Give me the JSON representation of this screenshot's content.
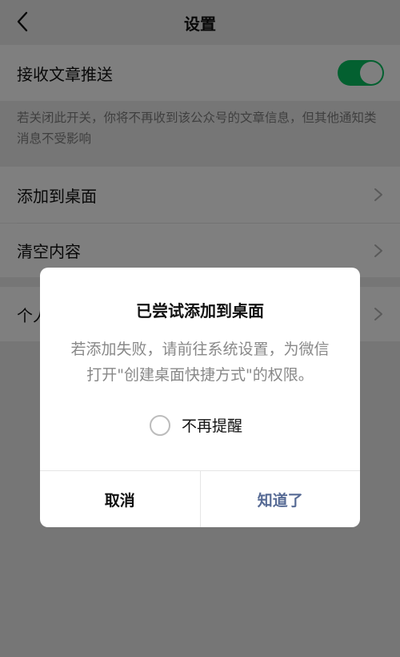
{
  "header": {
    "title": "设置"
  },
  "settings": {
    "push_label": "接收文章推送",
    "push_on": true,
    "push_desc": "若关闭此开关，你将不再收到该公众号的文章信息，但其他通知类消息不受影响",
    "add_desktop_label": "添加到桌面",
    "clear_label": "清空内容",
    "personal_label": "个人"
  },
  "dialog": {
    "title": "已尝试添加到桌面",
    "message": "若添加失败，请前往系统设置，为微信打开\"创建桌面快捷方式\"的权限。",
    "checkbox_label": "不再提醒",
    "cancel_label": "取消",
    "ok_label": "知道了"
  },
  "colors": {
    "accent": "#07c160",
    "link": "#576b95"
  }
}
